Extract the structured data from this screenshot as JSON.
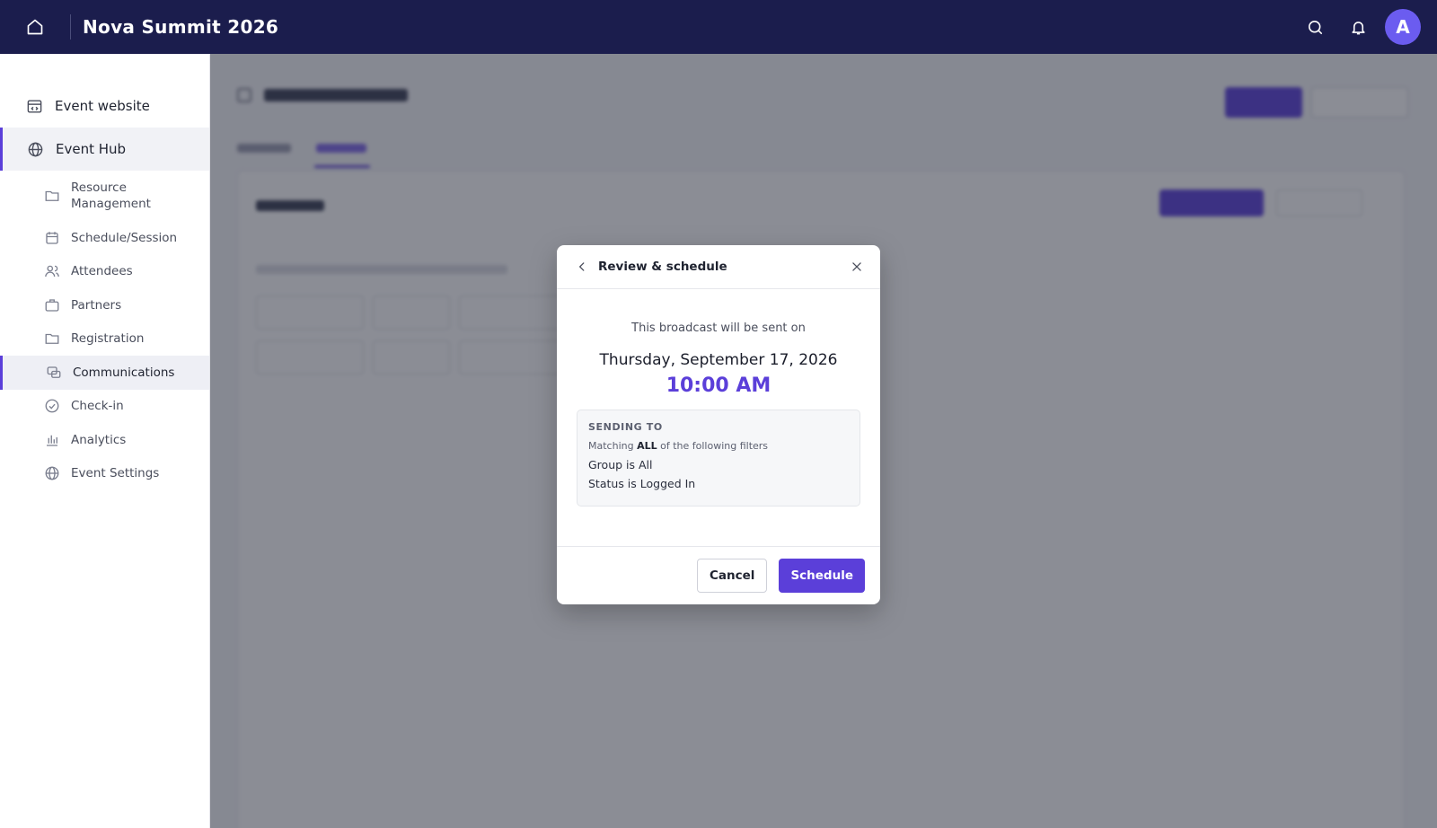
{
  "header": {
    "title": "Nova Summit 2026",
    "avatar_initial": "A",
    "icons": [
      "home-icon",
      "search-icon",
      "bell-icon"
    ]
  },
  "sidebar": {
    "top_items": [
      {
        "label": "Event website",
        "icon": "website-icon"
      },
      {
        "label": "Event Hub",
        "icon": "globe-icon"
      }
    ],
    "sub_items": [
      {
        "label": "Resource Management",
        "icon": "folder-icon"
      },
      {
        "label": "Schedule/Session",
        "icon": "calendar-icon"
      },
      {
        "label": "Attendees",
        "icon": "people-icon"
      },
      {
        "label": "Partners",
        "icon": "briefcase-icon"
      },
      {
        "label": "Registration",
        "icon": "folder-icon"
      },
      {
        "label": "Communications",
        "icon": "chat-icon"
      },
      {
        "label": "Check-in",
        "icon": "check-circle-icon"
      },
      {
        "label": "Analytics",
        "icon": "bar-chart-icon"
      },
      {
        "label": "Event Settings",
        "icon": "globe-icon"
      }
    ]
  },
  "modal": {
    "title": "Review & schedule",
    "sent_on_text": "This broadcast will be sent on",
    "date": "Thursday, September 17, 2026",
    "time": "10:00 AM",
    "summary": {
      "label": "SENDING TO",
      "match_prefix": "Matching",
      "match_keyword": "ALL",
      "match_suffix": "of the following filters",
      "rules": [
        "Group is All",
        "Status is Logged In"
      ]
    },
    "cancel_label": "Cancel",
    "schedule_label": "Schedule"
  },
  "colors": {
    "header_bg": "#1b1d4d",
    "accent": "#5b3fd9",
    "avatar": "#6b5cf0"
  }
}
